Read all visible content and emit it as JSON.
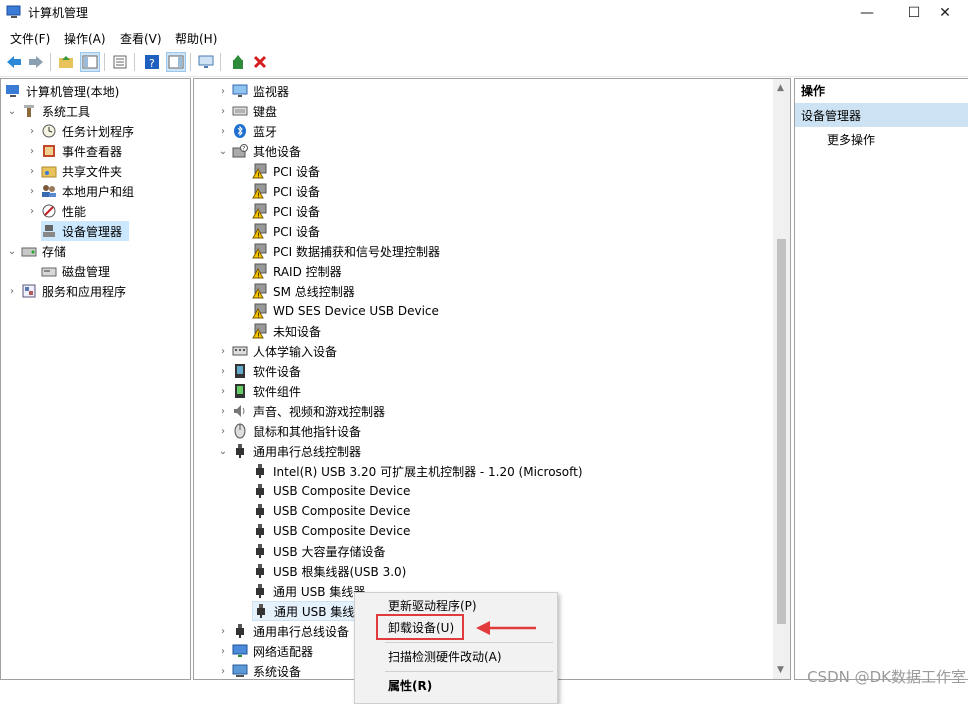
{
  "window": {
    "title": "计算机管理",
    "min_glyph": "—",
    "max_glyph": "☐",
    "close_glyph": "✕"
  },
  "menubar": [
    "文件(F)",
    "操作(A)",
    "查看(V)",
    "帮助(H)"
  ],
  "left_tree": [
    {
      "label": "计算机管理(本地)",
      "icon": "computer-management-icon",
      "expand": ""
    },
    {
      "label": "系统工具",
      "icon": "tools-icon",
      "expand": "⌄"
    },
    {
      "label": "任务计划程序",
      "icon": "clock-icon",
      "expand": "›"
    },
    {
      "label": "事件查看器",
      "icon": "event-viewer-icon",
      "expand": "›"
    },
    {
      "label": "共享文件夹",
      "icon": "shared-folder-icon",
      "expand": "›"
    },
    {
      "label": "本地用户和组",
      "icon": "users-icon",
      "expand": "›"
    },
    {
      "label": "性能",
      "icon": "performance-icon",
      "expand": "›"
    },
    {
      "label": "设备管理器",
      "icon": "device-manager-icon",
      "expand": ""
    },
    {
      "label": "存储",
      "icon": "storage-icon",
      "expand": "⌄"
    },
    {
      "label": "磁盘管理",
      "icon": "disk-icon",
      "expand": ""
    },
    {
      "label": "服务和应用程序",
      "icon": "services-icon",
      "expand": "›"
    }
  ],
  "device_tree": [
    {
      "label": "监视器",
      "icon": "monitor-icon",
      "expand": "›",
      "level": 0
    },
    {
      "label": "键盘",
      "icon": "keyboard-icon",
      "expand": "›",
      "level": 0
    },
    {
      "label": "蓝牙",
      "icon": "bluetooth-icon",
      "expand": "›",
      "level": 0
    },
    {
      "label": "其他设备",
      "icon": "unknown-device-icon",
      "expand": "⌄",
      "level": 0
    },
    {
      "label": "PCI 设备",
      "icon": "warning-device-icon",
      "expand": "",
      "level": 1
    },
    {
      "label": "PCI 设备",
      "icon": "warning-device-icon",
      "expand": "",
      "level": 1
    },
    {
      "label": "PCI 设备",
      "icon": "warning-device-icon",
      "expand": "",
      "level": 1
    },
    {
      "label": "PCI 设备",
      "icon": "warning-device-icon",
      "expand": "",
      "level": 1
    },
    {
      "label": "PCI 数据捕获和信号处理控制器",
      "icon": "warning-device-icon",
      "expand": "",
      "level": 1
    },
    {
      "label": "RAID 控制器",
      "icon": "warning-device-icon",
      "expand": "",
      "level": 1
    },
    {
      "label": "SM 总线控制器",
      "icon": "warning-device-icon",
      "expand": "",
      "level": 1
    },
    {
      "label": "WD SES Device USB Device",
      "icon": "warning-device-icon",
      "expand": "",
      "level": 1
    },
    {
      "label": "未知设备",
      "icon": "warning-device-icon",
      "expand": "",
      "level": 1
    },
    {
      "label": "人体学输入设备",
      "icon": "hid-icon",
      "expand": "›",
      "level": 0
    },
    {
      "label": "软件设备",
      "icon": "software-device-icon",
      "expand": "›",
      "level": 0
    },
    {
      "label": "软件组件",
      "icon": "software-component-icon",
      "expand": "›",
      "level": 0
    },
    {
      "label": "声音、视频和游戏控制器",
      "icon": "speaker-icon",
      "expand": "›",
      "level": 0
    },
    {
      "label": "鼠标和其他指针设备",
      "icon": "mouse-icon",
      "expand": "›",
      "level": 0
    },
    {
      "label": "通用串行总线控制器",
      "icon": "usb-icon",
      "expand": "⌄",
      "level": 0
    },
    {
      "label": "Intel(R) USB 3.20 可扩展主机控制器 - 1.20 (Microsoft)",
      "icon": "usb-icon",
      "expand": "",
      "level": 1
    },
    {
      "label": "USB Composite Device",
      "icon": "usb-icon",
      "expand": "",
      "level": 1
    },
    {
      "label": "USB Composite Device",
      "icon": "usb-icon",
      "expand": "",
      "level": 1
    },
    {
      "label": "USB Composite Device",
      "icon": "usb-icon",
      "expand": "",
      "level": 1
    },
    {
      "label": "USB 大容量存储设备",
      "icon": "usb-icon",
      "expand": "",
      "level": 1
    },
    {
      "label": "USB 根集线器(USB 3.0)",
      "icon": "usb-icon",
      "expand": "",
      "level": 1
    },
    {
      "label": "通用 USB 集线器",
      "icon": "usb-icon",
      "expand": "",
      "level": 1
    },
    {
      "label": "通用 USB 集线器",
      "icon": "usb-icon",
      "expand": "",
      "level": 1
    },
    {
      "label": "通用串行总线设备",
      "icon": "usb-icon",
      "expand": "›",
      "level": 0
    },
    {
      "label": "网络适配器",
      "icon": "network-icon",
      "expand": "›",
      "level": 0
    },
    {
      "label": "系统设备",
      "icon": "system-device-icon",
      "expand": "›",
      "level": 0
    }
  ],
  "actions": {
    "header": "操作",
    "section": "设备管理器",
    "more": "更多操作"
  },
  "context_menu": [
    {
      "label": "更新驱动程序(P)",
      "bold": false
    },
    {
      "label": "卸载设备(U)",
      "bold": false
    },
    {
      "label": "扫描检测硬件改动(A)",
      "bold": false
    },
    {
      "label": "属性(R)",
      "bold": true
    }
  ],
  "watermark": "CSDN @DK数据工作室",
  "colors": {
    "highlight_red": "#e23b3b",
    "selection_blue": "#cce8ff"
  }
}
